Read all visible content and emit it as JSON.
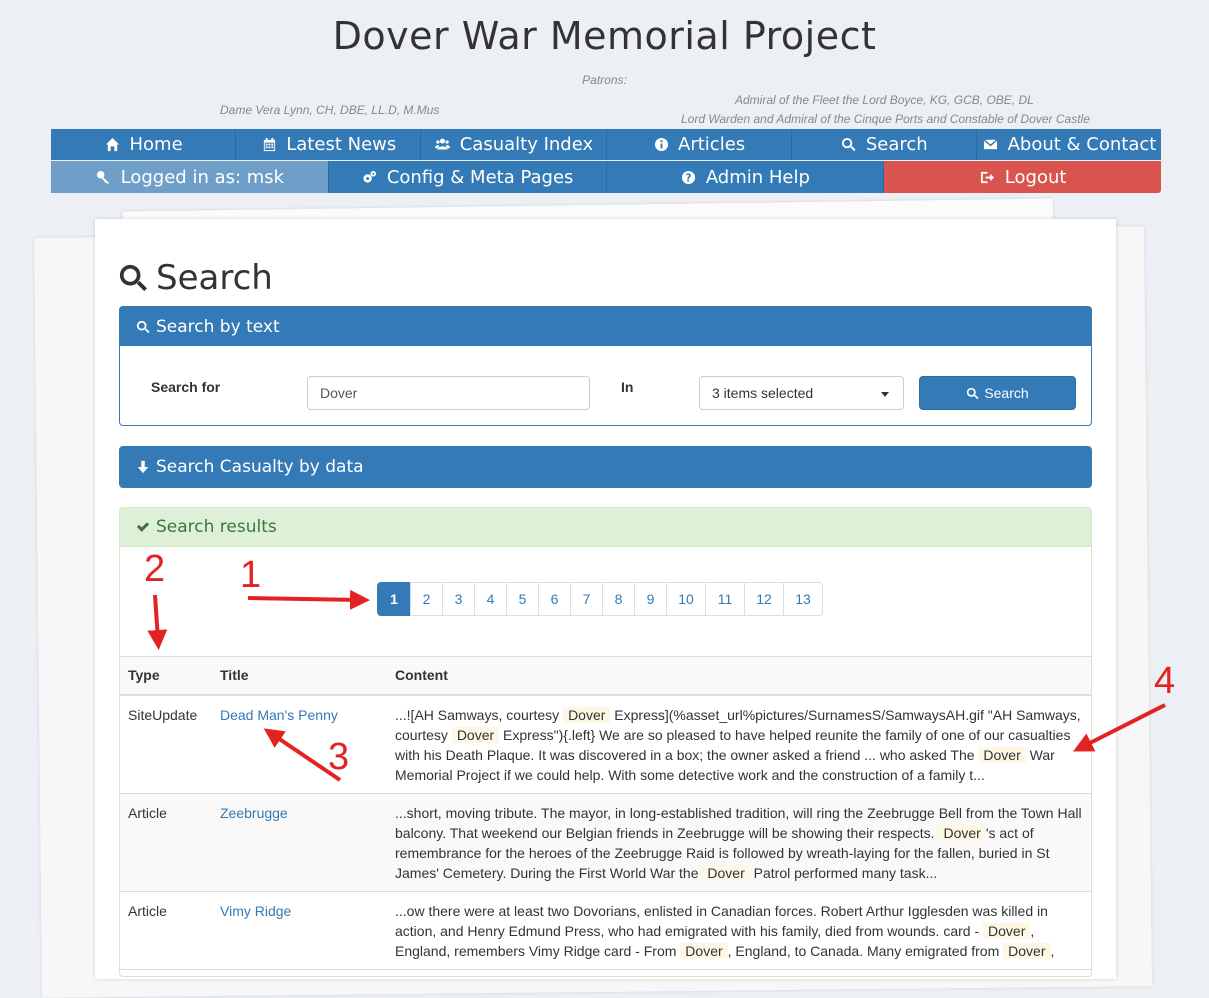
{
  "header": {
    "title": "Dover War Memorial Project",
    "patrons_label": "Patrons:",
    "patron_1": "Dame Vera Lynn, CH, DBE, LL.D, M.Mus",
    "patron_2_line1": "Admiral of the Fleet the Lord Boyce, KG, GCB, OBE, DL",
    "patron_2_line2": "Lord Warden and Admiral of the Cinque Ports and Constable of Dover Castle"
  },
  "nav": {
    "row1": [
      {
        "label": "Home",
        "icon": "home-icon"
      },
      {
        "label": "Latest News",
        "icon": "calendar-icon"
      },
      {
        "label": "Casualty Index",
        "icon": "users-icon"
      },
      {
        "label": "Articles",
        "icon": "info-icon"
      },
      {
        "label": "Search",
        "icon": "search-icon"
      },
      {
        "label": "About & Contact",
        "icon": "envelope-icon"
      }
    ],
    "row2": [
      {
        "label": "Logged in as: msk",
        "icon": "key-icon"
      },
      {
        "label": "Config & Meta Pages",
        "icon": "gears-icon"
      },
      {
        "label": "Admin Help",
        "icon": "question-icon"
      },
      {
        "label": "Logout",
        "icon": "logout-icon"
      }
    ]
  },
  "page": {
    "heading": "Search"
  },
  "search_text_panel": {
    "title": "Search by text",
    "search_for_label": "Search for",
    "search_value": "Dover",
    "in_label": "In",
    "select_value": "3 items selected",
    "button_label": "Search"
  },
  "search_data_panel": {
    "title": "Search Casualty by data"
  },
  "results": {
    "title": "Search results",
    "pages": [
      "1",
      "2",
      "3",
      "4",
      "5",
      "6",
      "7",
      "8",
      "9",
      "10",
      "11",
      "12",
      "13"
    ],
    "active_page": "1",
    "columns": [
      "Type",
      "Title",
      "Content"
    ],
    "rows": [
      {
        "type": "SiteUpdate",
        "title": "Dead Man's Penny",
        "content": [
          {
            "t": "...![AH Samways, courtesy "
          },
          {
            "t": "Dover",
            "hl": true
          },
          {
            "t": " Express](%asset_url%pictures/SurnamesS/SamwaysAH.gif \"AH Samways, courtesy "
          },
          {
            "t": "Dover",
            "hl": true
          },
          {
            "t": " Express\"){.left} We are so pleased to have helped reunite the family of one of our casualties with his Death Plaque. It was discovered in a box; the owner asked a friend ... who asked The "
          },
          {
            "t": "Dover",
            "hl": true
          },
          {
            "t": " War Memorial Project if we could help. With some detective work and the construction of a family t..."
          }
        ]
      },
      {
        "type": "Article",
        "title": "Zeebrugge",
        "content": [
          {
            "t": "...short, moving tribute. The mayor, in long-established tradition, will ring the Zeebrugge Bell from the Town Hall balcony. That weekend our Belgian friends in Zeebrugge will be showing their respects. "
          },
          {
            "t": "Dover",
            "hl": true
          },
          {
            "t": "'s act of remembrance for the heroes of the Zeebrugge Raid is followed by wreath-laying for the fallen, buried in St James' Cemetery. During the First World War the "
          },
          {
            "t": "Dover",
            "hl": true
          },
          {
            "t": " Patrol performed many task..."
          }
        ]
      },
      {
        "type": "Article",
        "title": "Vimy Ridge",
        "content": [
          {
            "t": "...ow there were at least two Dovorians, enlisted in Canadian forces. Robert Arthur Igglesden was killed in action, and Henry Edmund Press, who had emigrated with his family, died from wounds. card - "
          },
          {
            "t": "Dover",
            "hl": true
          },
          {
            "t": ", England, remembers Vimy Ridge card - From "
          },
          {
            "t": "Dover",
            "hl": true
          },
          {
            "t": ", England, to Canada. Many emigrated from "
          },
          {
            "t": "Dover",
            "hl": true
          },
          {
            "t": ","
          }
        ]
      }
    ]
  },
  "annotations": {
    "a1": "1",
    "a2": "2",
    "a3": "3",
    "a4": "4",
    "color": "#e32222"
  }
}
